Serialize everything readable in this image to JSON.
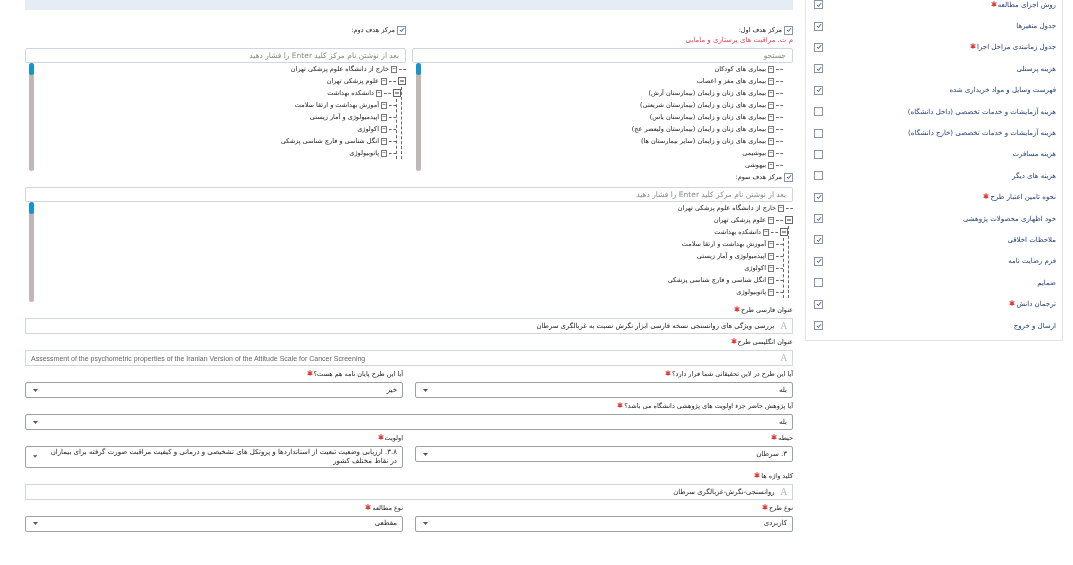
{
  "sidebar": {
    "items": [
      {
        "label": "روش اجرای مطالعه",
        "required": true,
        "checked": true
      },
      {
        "label": "جدول متغیرها",
        "required": false,
        "checked": true
      },
      {
        "label": "جدول زمانبندی مراحل اجرا",
        "required": true,
        "checked": true
      },
      {
        "label": "هزینه پرسنلی",
        "required": false,
        "checked": true
      },
      {
        "label": "فهرست وسایل و مواد خریداری شده",
        "required": false,
        "checked": true
      },
      {
        "label": "هزینه آزمایشات و خدمات تخصصی (داخل دانشگاه)",
        "required": false,
        "checked": false
      },
      {
        "label": "هزینه آزمایشات و خدمات تخصصی (خارج دانشگاه)",
        "required": false,
        "checked": false
      },
      {
        "label": "هزینه مسافرت",
        "required": false,
        "checked": false
      },
      {
        "label": "هزینه های دیگر",
        "required": false,
        "checked": false
      },
      {
        "label": "نحوه تامین اعتبار طرح",
        "required": true,
        "checked": true
      },
      {
        "label": "خود اظهاری محصولات پژوهشی",
        "required": false,
        "checked": true
      },
      {
        "label": "ملاحظات اخلاقی",
        "required": false,
        "checked": true
      },
      {
        "label": "فرم رضایت نامه",
        "required": false,
        "checked": true
      },
      {
        "label": "ضمایم",
        "required": false,
        "checked": false
      },
      {
        "label": "ترجمان دانش",
        "required": true,
        "checked": true
      },
      {
        "label": "ارسال و خروج",
        "required": false,
        "checked": true
      }
    ]
  },
  "targets": [
    {
      "label": "مرکز هدف اول:",
      "checked": true,
      "note": "م ت. مراقبت های پرستاری و مامایی",
      "search": {
        "placeholder": "جستجو"
      },
      "tree": [
        {
          "label": "بیماری های کودکان"
        },
        {
          "label": "بیماری های مغز و اعصاب"
        },
        {
          "label": "بیماری های زنان و زایمان (بیمارستان آرش)"
        },
        {
          "label": "بیماری های زنان و زایمان (بیمارستان شریعتی)"
        },
        {
          "label": "بیماری های زنان و زایمان (بیمارستان یاس)"
        },
        {
          "label": "بیماری های زنان و زایمان (بیمارستان ولیعصر عج)"
        },
        {
          "label": "بیماری های زنان و زایمان (سایر بیمارستان ها)"
        },
        {
          "label": "بیوشیمی"
        },
        {
          "label": "بیهوشی"
        }
      ]
    },
    {
      "label": "مرکز هدف دوم:",
      "checked": true,
      "search": {
        "placeholder": "بعد از نوشتن نام مرکز کلید Enter را فشار دهید"
      },
      "tree": [
        {
          "label": "خارج از دانشگاه علوم پزشکی تهران"
        },
        {
          "label": "علوم پزشکی تهران",
          "expanded": true,
          "children": [
            {
              "label": "دانشکده بهداشت",
              "expanded": true,
              "children": [
                {
                  "label": "آموزش بهداشت و ارتقا سلامت"
                },
                {
                  "label": "اپیدمیولوژی و آمار زیستی"
                },
                {
                  "label": "اکولوژی"
                },
                {
                  "label": "انگل شناسی و قارچ شناسی پزشکی"
                },
                {
                  "label": "پاتوبیولوژی"
                }
              ]
            }
          ]
        }
      ]
    },
    {
      "label": "مرکز هدف سوم:",
      "checked": true,
      "search": {
        "placeholder": "بعد از نوشتن نام مرکز کلید Enter را فشار دهید"
      },
      "tree": [
        {
          "label": "خارج از دانشگاه علوم پزشکی تهران"
        },
        {
          "label": "علوم پزشکی تهران",
          "expanded": true,
          "children": [
            {
              "label": "دانشکده بهداشت",
              "expanded": true,
              "children": [
                {
                  "label": "آموزش بهداشت و ارتقا سلامت"
                },
                {
                  "label": "اپیدمیولوژی و آمار زیستی"
                },
                {
                  "label": "اکولوژی"
                },
                {
                  "label": "انگل شناسی و قارچ شناسی پزشکی"
                },
                {
                  "label": "پاتوبیولوژی"
                }
              ]
            }
          ]
        }
      ]
    }
  ],
  "form": {
    "rows": [
      [
        {
          "kind": "text",
          "label": "عنوان فارسی طرح",
          "required": true,
          "adornment": "A",
          "value": "بررسی ویژگی های روانسنجی نسخه فارسی ابزار نگرش نسبت به غربالگری سرطان"
        }
      ],
      [
        {
          "kind": "text_en",
          "label": "عنوان انگلیسی طرح",
          "required": true,
          "adornment": "A",
          "value": "Assessment of the psychometric properties of the Iranian Version of the Attitude Scale for Cancer Screening"
        }
      ],
      [
        {
          "kind": "select",
          "label": "آیا این طرح در لاین تحقیقاتی شما قرار دارد؟",
          "required": true,
          "value": "بله"
        },
        {
          "kind": "select",
          "label": "آیا این طرح پایان نامه هم هست؟",
          "required": true,
          "value": "خیر"
        }
      ],
      [
        {
          "kind": "select",
          "label": "آیا پژوهش حاضر جزء اولویت های پژوهشی دانشگاه می باشد؟",
          "required": true,
          "value": "بله"
        }
      ],
      [
        {
          "kind": "select",
          "label": "حیطه",
          "required": true,
          "value": "۳. سرطان"
        },
        {
          "kind": "select",
          "label": "اولویت",
          "required": true,
          "value": "۳.۸. ارزیابی وضعیت تبعیت از استانداردها و پروتکل های تشخیصی و درمانی و کیفیت مراقبت صورت گرفته برای بیماران در نقاط مختلف کشور"
        }
      ],
      [
        {
          "kind": "text",
          "label": "کلید واژه ها",
          "required": true,
          "adornment": "A",
          "value": "روانسنجی-نگرش-غربالگری سرطان"
        }
      ],
      [
        {
          "kind": "select",
          "label": "نوع طرح",
          "required": true,
          "value": "کاربردی"
        },
        {
          "kind": "select",
          "label": "نوع مطالعه",
          "required": true,
          "value": "مقطعی"
        }
      ]
    ]
  }
}
